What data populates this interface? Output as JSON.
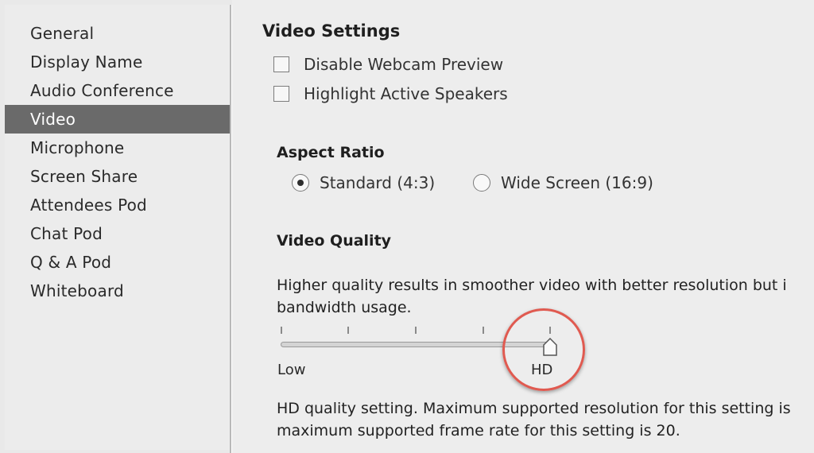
{
  "sidebar": {
    "items": [
      {
        "label": "General"
      },
      {
        "label": "Display Name"
      },
      {
        "label": "Audio Conference"
      },
      {
        "label": "Video"
      },
      {
        "label": "Microphone"
      },
      {
        "label": "Screen Share"
      },
      {
        "label": "Attendees Pod"
      },
      {
        "label": "Chat Pod"
      },
      {
        "label": "Q & A Pod"
      },
      {
        "label": "Whiteboard"
      }
    ],
    "selected": "Video"
  },
  "main": {
    "title": "Video Settings",
    "options": {
      "disable_webcam_preview": {
        "label": "Disable Webcam Preview",
        "checked": false
      },
      "highlight_active_speakers": {
        "label": "Highlight Active Speakers",
        "checked": false
      }
    },
    "aspect_ratio": {
      "heading": "Aspect Ratio",
      "choices": [
        {
          "label": "Standard (4:3)",
          "selected": true
        },
        {
          "label": "Wide Screen (16:9)",
          "selected": false
        }
      ]
    },
    "video_quality": {
      "heading": "Video Quality",
      "description_line1": "Higher quality results in smoother video with better resolution but i",
      "description_line2": "bandwidth usage.",
      "slider": {
        "min_label": "Low",
        "max_label": "HD",
        "value_fraction": 1.0
      },
      "setting_line1": "HD quality setting. Maximum supported resolution for this setting is",
      "setting_line2": "maximum supported frame rate for this setting is 20."
    }
  },
  "colors": {
    "background": "#e9e9e9",
    "sidebar_selected": "#6a6a6a",
    "highlight_circle": "#e05a50"
  },
  "icons": [
    "checkbox-icon",
    "radio-icon",
    "slider-thumb-icon"
  ]
}
